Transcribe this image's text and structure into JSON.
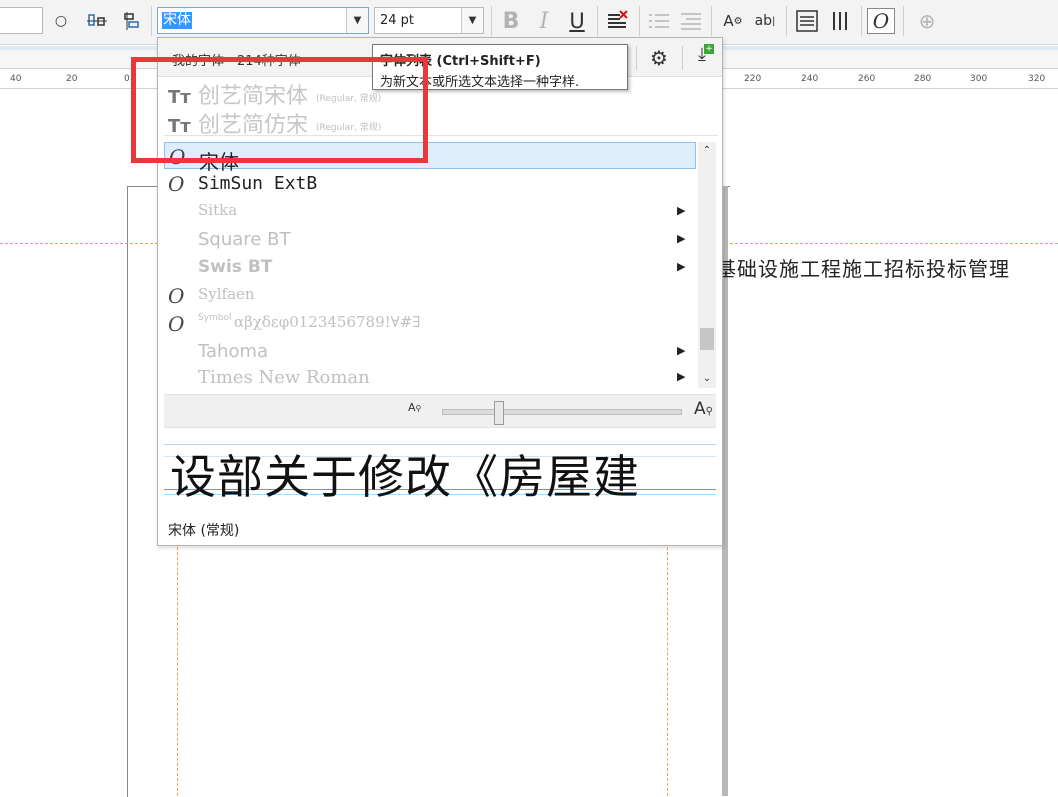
{
  "toolbar": {
    "font_name": "宋体",
    "font_size": "24 pt",
    "bold_label": "B",
    "italic_label": "I",
    "underline_label": "U",
    "icons": [
      "circle-icon",
      "align-icon",
      "distribute-icon",
      "text-color-icon",
      "bullet-list-icon",
      "paragraph-icon",
      "char-format-icon",
      "text-replace-icon",
      "column-format-icon",
      "vertical-text-icon",
      "font-list-icon",
      "add-icon"
    ]
  },
  "ruler": {
    "labels_left": [
      "40",
      "20",
      "0"
    ],
    "labels_right": [
      "220",
      "240",
      "260",
      "280",
      "300",
      "320"
    ]
  },
  "canvas": {
    "text": "基础设施工程施工招标投标管理"
  },
  "font_popup": {
    "header": "我的字体 - 214种字体",
    "recent": [
      {
        "name": "创艺简宋体",
        "style": "(Regular, 常规)"
      },
      {
        "name": "创艺简仿宋",
        "style": "(Regular, 常规)"
      }
    ],
    "fonts": [
      {
        "name": "宋体",
        "selected": true
      },
      {
        "name": "SimSun ExtB"
      },
      {
        "name": "Sitka"
      },
      {
        "name": "Square BT"
      },
      {
        "name": "Swis BT"
      },
      {
        "name": "Sylfaen"
      },
      {
        "name": "Symbol",
        "sample": "αβχδεφ0123456789!∀#∃"
      },
      {
        "name": "Tahoma"
      },
      {
        "name": "Times New Roman"
      }
    ],
    "preview_text": "设部关于修改《房屋建",
    "footer": "宋体 (常规)"
  },
  "tooltip": {
    "title": "字体列表 (Ctrl+Shift+F)",
    "desc": "为新文本或所选文本选择一种字样."
  },
  "colors": {
    "highlight": "#e8393a",
    "selection": "#dceefb",
    "guide": "#f0a050"
  }
}
